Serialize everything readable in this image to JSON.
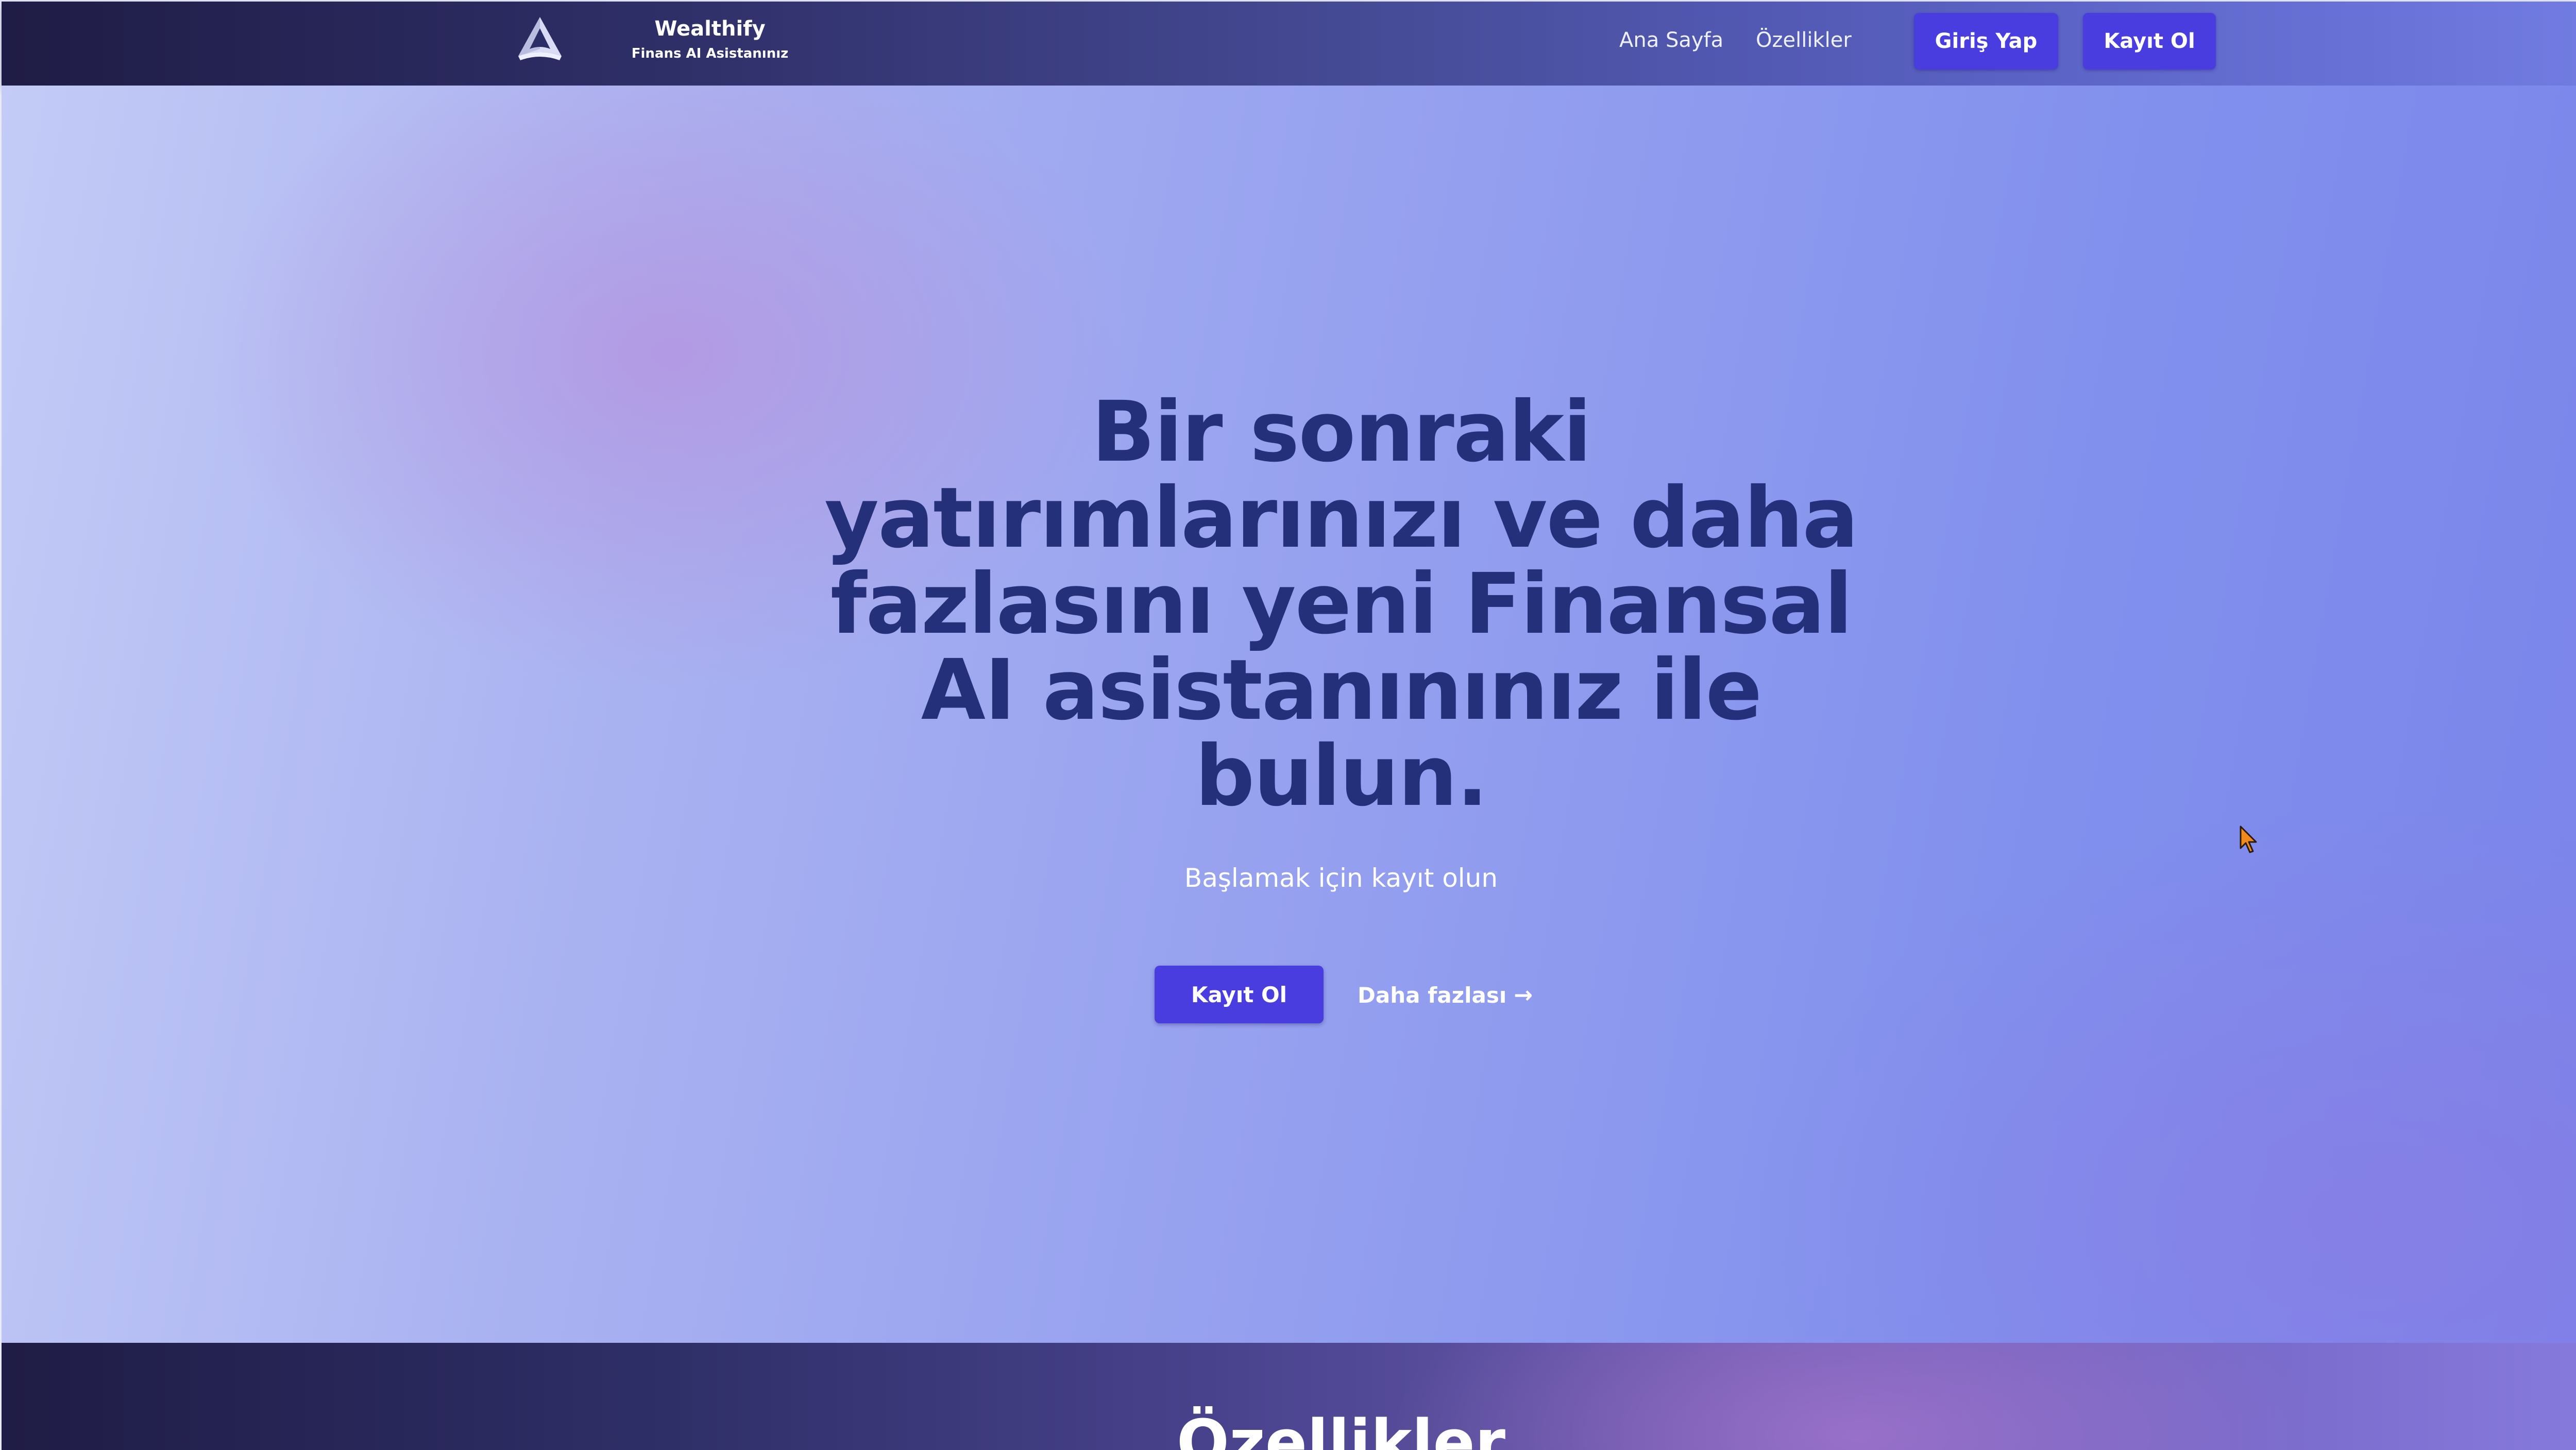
{
  "brand": {
    "name": "Wealthify",
    "tagline": "Finans AI Asistanınız",
    "logo_icon": "triangle-logo-icon"
  },
  "nav": {
    "links": [
      "Ana Sayfa",
      "Özellikler"
    ],
    "login_label": "Giriş Yap",
    "signup_label": "Kayıt Ol"
  },
  "hero": {
    "title": "Bir sonraki yatırımlarınızı ve daha fazlasını yeni Finansal AI asistanınınız ile bulun.",
    "subtitle": "Başlamak için kayıt olun",
    "signup_label": "Kayıt Ol",
    "more_label": "Daha fazlası",
    "more_icon": "arrow-right-icon"
  },
  "features": {
    "title": "Özellikler"
  },
  "colors": {
    "primary_button": "#4a3de0",
    "title_text": "#24307a",
    "nav_dark": "#1f1c45",
    "nav_light": "#7580e6"
  }
}
